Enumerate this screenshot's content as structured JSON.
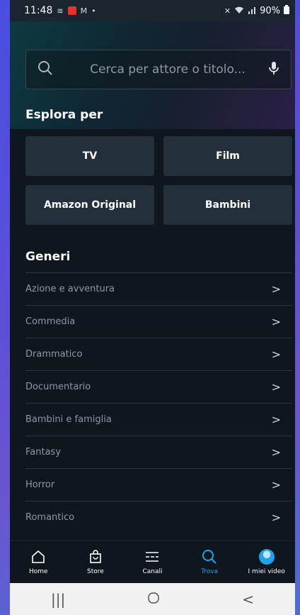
{
  "status": {
    "time": "11:48",
    "battery": "90%"
  },
  "search": {
    "placeholder": "Cerca per attore o titolo..."
  },
  "explore": {
    "title": "Esplora per",
    "tiles": [
      "TV",
      "Film",
      "Amazon Original",
      "Bambini"
    ]
  },
  "genres": {
    "title": "Generi",
    "items": [
      "Azione e avventura",
      "Commedia",
      "Drammatico",
      "Documentario",
      "Bambini e famiglia",
      "Fantasy",
      "Horror",
      "Romantico"
    ]
  },
  "nav": {
    "items": [
      {
        "label": "Home",
        "icon": "home-icon"
      },
      {
        "label": "Store",
        "icon": "bag-icon"
      },
      {
        "label": "Canali",
        "icon": "channels-icon"
      },
      {
        "label": "Trova",
        "icon": "search-icon"
      },
      {
        "label": "I miei video",
        "icon": "avatar-icon"
      }
    ],
    "active": "Trova",
    "active_color": "#1fa3e8"
  },
  "system_nav": {
    "buttons": [
      "recents-icon",
      "home-circle-icon",
      "back-icon"
    ]
  }
}
